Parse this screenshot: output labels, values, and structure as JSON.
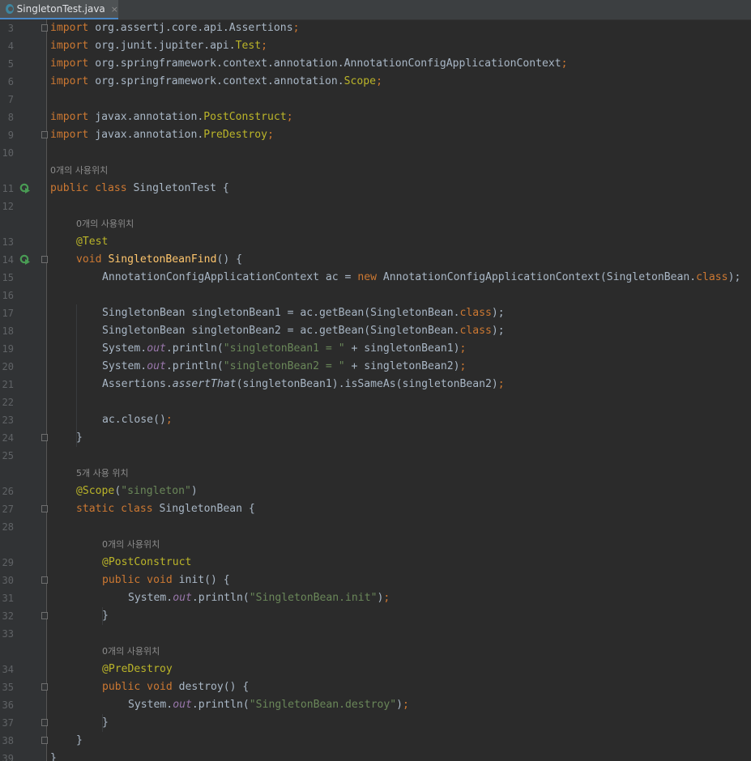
{
  "tab": {
    "title": "SingletonTest.java",
    "close_glyph": "×"
  },
  "hints": {
    "class_usages": "0개의 사용위치",
    "method_usages": "0개의 사용위치",
    "bean_usages": "5개 사용 위치",
    "init_usages": "0개의 사용위치",
    "destroy_usages": "0개의 사용위치"
  },
  "lines": {
    "n3": "3",
    "n4": "4",
    "n5": "5",
    "n6": "6",
    "n7": "7",
    "n8": "8",
    "n9": "9",
    "n10": "10",
    "n11": "11",
    "n12": "12",
    "n13": "13",
    "n14": "14",
    "n15": "15",
    "n16": "16",
    "n17": "17",
    "n18": "18",
    "n19": "19",
    "n20": "20",
    "n21": "21",
    "n22": "22",
    "n23": "23",
    "n24": "24",
    "n25": "25",
    "n26": "26",
    "n27": "27",
    "n28": "28",
    "n29": "29",
    "n30": "30",
    "n31": "31",
    "n32": "32",
    "n33": "33",
    "n34": "34",
    "n35": "35",
    "n36": "36",
    "n37": "37",
    "n38": "38",
    "n39": "39"
  },
  "code": {
    "l3": [
      "import",
      " org.assertj.core.api.Assertions",
      ";"
    ],
    "l4": [
      "import",
      " org.junit.jupiter.api.",
      "Test",
      ";"
    ],
    "l5": [
      "import",
      " org.springframework.context.annotation.AnnotationConfigApplicationContext",
      ";"
    ],
    "l6": [
      "import",
      " org.springframework.context.annotation.",
      "Scope",
      ";"
    ],
    "l8": [
      "import",
      " javax.annotation.",
      "PostConstruct",
      ";"
    ],
    "l9": [
      "import",
      " javax.annotation.",
      "PreDestroy",
      ";"
    ],
    "l11": [
      "public class",
      " SingletonTest {"
    ],
    "l13": [
      "@Test"
    ],
    "l14": [
      "void",
      " ",
      "SingletonBeanFind",
      "() {"
    ],
    "l15": [
      "AnnotationConfigApplicationContext ac = ",
      "new",
      " AnnotationConfigApplicationContext(SingletonBean.",
      "class",
      ");"
    ],
    "l17": [
      "SingletonBean singletonBean1 = ac.getBean(SingletonBean.",
      "class",
      ");"
    ],
    "l18": [
      "SingletonBean singletonBean2 = ac.getBean(SingletonBean.",
      "class",
      ");"
    ],
    "l19": [
      "System.",
      "out",
      ".println(",
      "\"singletonBean1 = \"",
      " + singletonBean1)",
      ";"
    ],
    "l20": [
      "System.",
      "out",
      ".println(",
      "\"singletonBean2 = \"",
      " + singletonBean2)",
      ";"
    ],
    "l21": [
      "Assertions.",
      "assertThat",
      "(singletonBean1).isSameAs(singletonBean2)",
      ";"
    ],
    "l23": [
      "ac.close()",
      ";"
    ],
    "l24": [
      "}"
    ],
    "l26": [
      "@Scope",
      "(",
      "\"singleton\"",
      ")"
    ],
    "l27": [
      "static class",
      " SingletonBean {"
    ],
    "l29": [
      "@PostConstruct"
    ],
    "l30": [
      "public void",
      " init() {"
    ],
    "l31": [
      "System.",
      "out",
      ".println(",
      "\"SingletonBean.init\"",
      ")",
      ";"
    ],
    "l32": [
      "}"
    ],
    "l34": [
      "@PreDestroy"
    ],
    "l35": [
      "public void",
      " destroy() {"
    ],
    "l36": [
      "System.",
      "out",
      ".println(",
      "\"SingletonBean.destroy\"",
      ")",
      ";"
    ],
    "l37": [
      "}"
    ],
    "l38": [
      "}"
    ],
    "l39": [
      "}"
    ]
  },
  "colors": {
    "background": "#2b2b2b",
    "gutter": "#313335",
    "keyword": "#cc7832",
    "annotation": "#bbb529",
    "method": "#ffc66d",
    "string": "#6a8759",
    "field": "#9876aa",
    "text": "#a9b7c6",
    "run_icon": "#499c54"
  },
  "icons": [
    "run-test-icon",
    "fold-icon",
    "java-class-icon",
    "close-icon"
  ]
}
